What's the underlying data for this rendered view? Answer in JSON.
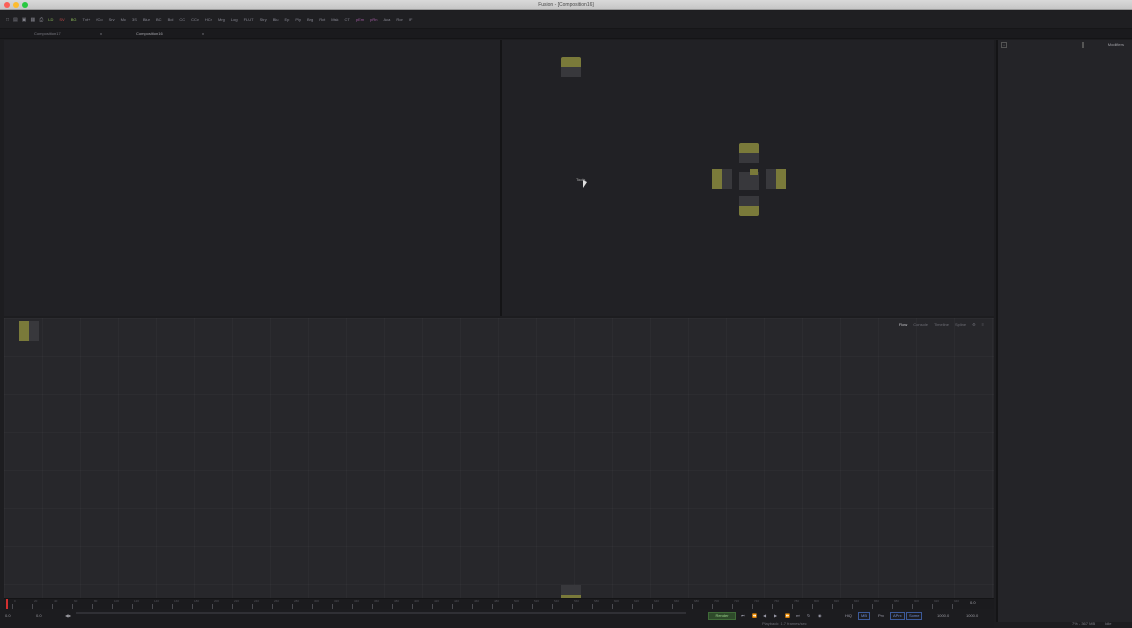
{
  "window": {
    "title": "Fusion - [Composition16]"
  },
  "toolbar": {
    "icons": [
      "new-icon",
      "open-icon",
      "save-icon",
      "copy-icon",
      "print-icon"
    ],
    "tools": [
      "LD",
      "SV",
      "BG",
      "Txt+",
      "fCo",
      "Srv",
      "Mc",
      "3S",
      "Blur",
      "BC",
      "Bol",
      "CC",
      "CCv",
      "HCr",
      "Mrg",
      "Log",
      "FLUT",
      "Stry",
      "Blu",
      "Ep",
      "Ply",
      "Brg",
      "Rct",
      "Msk",
      "CT",
      "pEm",
      "pRn",
      "Aca",
      "Ror",
      "IF"
    ]
  },
  "tabs": [
    {
      "label": "Composition17",
      "close": "x"
    },
    {
      "label": "Composition16",
      "close": "x"
    }
  ],
  "viewer": {
    "tool_label": "Tools"
  },
  "flow": {
    "tabs": [
      "Flow",
      "Console",
      "Timeline",
      "Spline",
      "⚙",
      "≡"
    ]
  },
  "ruler": {
    "labels": [
      "0",
      "20",
      "40",
      "60",
      "80",
      "100",
      "120",
      "140",
      "160",
      "180",
      "200",
      "220",
      "240",
      "260",
      "280",
      "300",
      "320",
      "340",
      "360",
      "380",
      "400",
      "420",
      "440",
      "460",
      "480",
      "500",
      "520",
      "540",
      "560",
      "580",
      "600",
      "620",
      "640",
      "660",
      "680",
      "700",
      "720",
      "740",
      "760",
      "780",
      "800",
      "820",
      "840",
      "860",
      "880",
      "900",
      "920",
      "940"
    ],
    "end_value": "0.0"
  },
  "transport": {
    "start": "0.0",
    "current": "0.0",
    "step": "◀▶",
    "render_label": "Render",
    "buttons": [
      "⏮",
      "⏪",
      "◀",
      "▶",
      "⏩",
      "⏭",
      "↻",
      "◉"
    ],
    "hq": "HiQ",
    "mb": "MB",
    "prx": "Prx",
    "aprx": "APrx",
    "some": "Some",
    "end_label": "1000.0",
    "end_value": "1000.0",
    "playback_status": "Playback: 1.7 frames/sec"
  },
  "inspector": {
    "title": "Modifiers",
    "pin": "⌂"
  },
  "status": {
    "memory": "7% - 367 MB",
    "state": "Idle"
  },
  "colors": {
    "node_accent": "#7a7a3a",
    "render_green": "#9bd28c",
    "playhead_red": "#d23030"
  }
}
